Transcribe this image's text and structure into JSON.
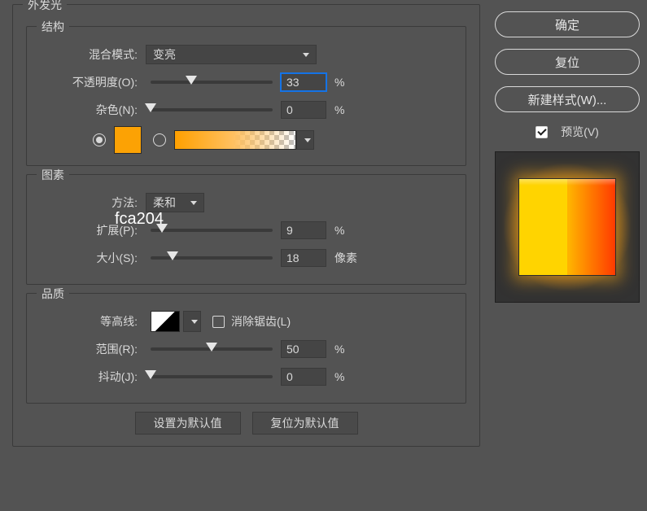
{
  "panel_title": "外发光",
  "structure": {
    "title": "结构",
    "blend_label": "混合模式:",
    "blend_value": "变亮",
    "opacity_label": "不透明度(O):",
    "opacity_value": "33",
    "opacity_unit": "%",
    "noise_label": "杂色(N):",
    "noise_value": "0",
    "noise_unit": "%",
    "solid_color": "#fca204",
    "hex_text": "fca204"
  },
  "elements": {
    "title": "图素",
    "technique_label": "方法:",
    "technique_value": "柔和",
    "spread_label": "扩展(P):",
    "spread_value": "9",
    "spread_unit": "%",
    "size_label": "大小(S):",
    "size_value": "18",
    "size_unit": "像素"
  },
  "quality": {
    "title": "品质",
    "contour_label": "等高线:",
    "antialias_label": "消除锯齿(L)",
    "range_label": "范围(R):",
    "range_value": "50",
    "range_unit": "%",
    "jitter_label": "抖动(J):",
    "jitter_value": "0",
    "jitter_unit": "%"
  },
  "footer": {
    "make_default": "设置为默认值",
    "reset_default": "复位为默认值"
  },
  "side": {
    "ok": "确定",
    "reset": "复位",
    "new_style": "新建样式(W)...",
    "preview": "预览(V)"
  }
}
